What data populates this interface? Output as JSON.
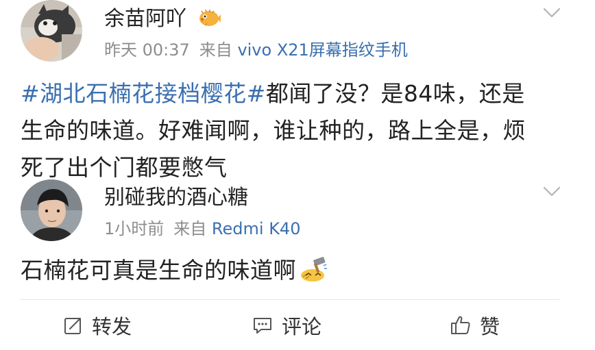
{
  "post": {
    "author": "余苗阿吖",
    "time": "昨天 00:37",
    "from_label": "来自",
    "source": "vivo X21屏幕指纹手机",
    "hashtag": "#湖北石楠花接档樱花#",
    "text_line1_rest": "都闻了没？是84味，还是",
    "text_line2": "生命的味道。好难闻啊，谁让种的，路上全是，烦",
    "text_line3": "死了出个门都要憋气"
  },
  "comment": {
    "author": "别碰我的酒心糖",
    "time": "1小时前",
    "from_label": "来自",
    "source": "Redmi K40",
    "text": "石楠花可真是生命的味道啊"
  },
  "actions": {
    "repost": "转发",
    "comment": "评论",
    "like": "赞"
  },
  "colors": {
    "link": "#3a6fb0",
    "meta": "#8d8d8d",
    "text": "#222222"
  },
  "icons": {
    "author_badge": "pufferfish-emoji-icon",
    "comment_emoji": "hammer-sweat-emoji-icon"
  }
}
